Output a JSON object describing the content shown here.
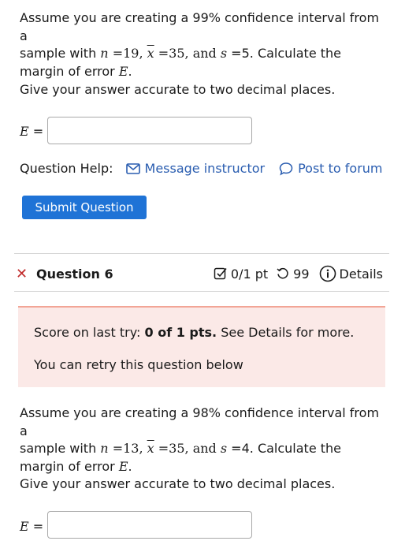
{
  "q5": {
    "para1": [
      "Assume you are creating a 99% confidence interval from a",
      "sample with ",
      "n",
      " =19, ",
      "x",
      " =35, and ",
      "s",
      " =5. Calculate the",
      "margin of error ",
      "E",
      "."
    ],
    "para2": "Give your answer accurate to two decimal places.",
    "answer_label_var": "E",
    "answer_label_eq": " =",
    "answer_value": ""
  },
  "help": {
    "label": "Question Help:",
    "message_link": "Message instructor",
    "forum_link": "Post to forum"
  },
  "submit_label": "Submit Question",
  "q6": {
    "title": "Question 6",
    "status_icon": "x-mark-icon",
    "score": "0/1 pt",
    "retries": "99",
    "details": "Details",
    "alert": {
      "prefix": "Score on last try: ",
      "score": "0 of 1 pts.",
      "suffix": " See Details for more.",
      "retry": "You can retry this question below"
    },
    "para1": [
      "Assume you are creating a 98% confidence interval from a",
      "sample with ",
      "n",
      " =13, ",
      "x",
      " =35, and ",
      "s",
      " =4. Calculate the",
      "margin of error ",
      "E",
      "."
    ],
    "para2": "Give your answer accurate to two decimal places.",
    "answer_label_var": "E",
    "answer_label_eq": " =",
    "answer_value": ""
  },
  "colors": {
    "link": "#2a5db0",
    "button": "#1f73d6",
    "alert_bg": "#fbe9e7",
    "alert_border": "#f2a596",
    "error": "#c22d2d"
  }
}
